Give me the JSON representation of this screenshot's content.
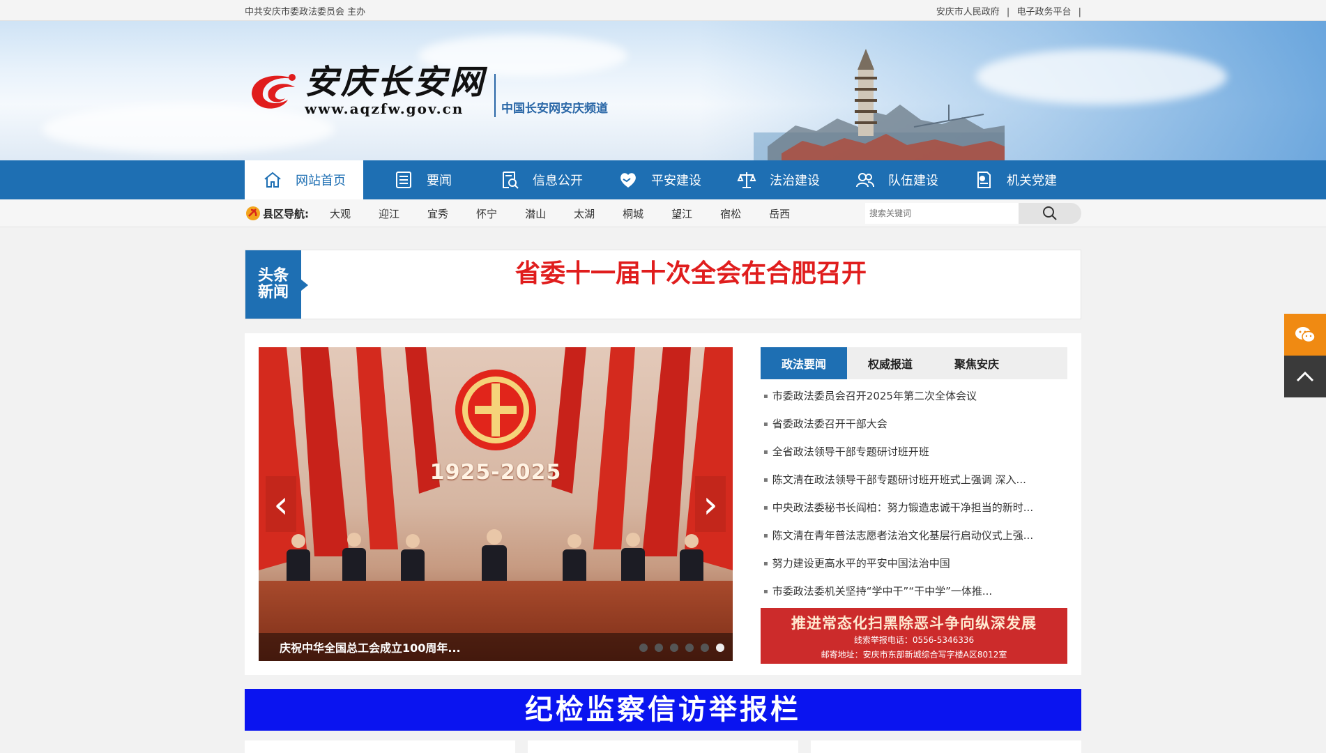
{
  "topbar": {
    "host": "中共安庆市委政法委员会 主办",
    "links": [
      "安庆市人民政府",
      "|",
      "电子政务平台",
      "|"
    ]
  },
  "banner": {
    "site_title": "安庆长安网",
    "site_url": "www.aqzfw.gov.cn",
    "site_sub": "中国长安网安庆频道"
  },
  "nav": {
    "items": [
      {
        "label": "网站首页",
        "icon": "home-icon"
      },
      {
        "label": "要闻",
        "icon": "document-icon"
      },
      {
        "label": "信息公开",
        "icon": "search-doc-icon"
      },
      {
        "label": "平安建设",
        "icon": "handshake-heart-icon"
      },
      {
        "label": "法治建设",
        "icon": "scales-icon"
      },
      {
        "label": "队伍建设",
        "icon": "people-icon"
      },
      {
        "label": "机关党建",
        "icon": "party-doc-icon"
      }
    ]
  },
  "county_nav": {
    "label": "县区导航:",
    "links": [
      "大观",
      "迎江",
      "宜秀",
      "怀宁",
      "潜山",
      "太湖",
      "桐城",
      "望江",
      "宿松",
      "岳西"
    ],
    "search_placeholder": "搜索关键词"
  },
  "headline": {
    "tag_line1": "头条",
    "tag_line2": "新闻",
    "title": "省委十一届十次全会在合肥召开"
  },
  "slider": {
    "years_text": "1925-2025",
    "caption": "庆祝中华全国总工会成立100周年...",
    "dots": 6,
    "active_dot": 5,
    "prev": "‹",
    "next": "›"
  },
  "news": {
    "tabs": [
      "政法要闻",
      "权威报道",
      "聚焦安庆"
    ],
    "active_tab": 0,
    "items": [
      "市委政法委员会召开2025年第二次全体会议",
      "省委政法委召开干部大会",
      "全省政法领导干部专题研讨班开班",
      "陈文清在政法领导干部专题研讨班开班式上强调 深入...",
      "中央政法委秘书长阎柏：努力锻造忠诚干净担当的新时...",
      "陈文清在青年普法志愿者法治文化基层行启动仪式上强...",
      "努力建设更高水平的平安中国法治中国",
      "市委政法委机关坚持“学中干”“干中学”一体推..."
    ],
    "ad": {
      "title": "推进常态化扫黑除恶斗争向纵深发展",
      "phone": "线索举报电话：0556-5346336",
      "address": "邮寄地址：安庆市东部新城综合写字楼A区8012室"
    }
  },
  "report_bar": {
    "text": "纪检监察信访举报栏"
  },
  "colors": {
    "brand_blue": "#1e6fb3",
    "headline_red": "#e01d1d",
    "report_blue": "#0a14f0",
    "wechat_orange": "#f08a12"
  }
}
